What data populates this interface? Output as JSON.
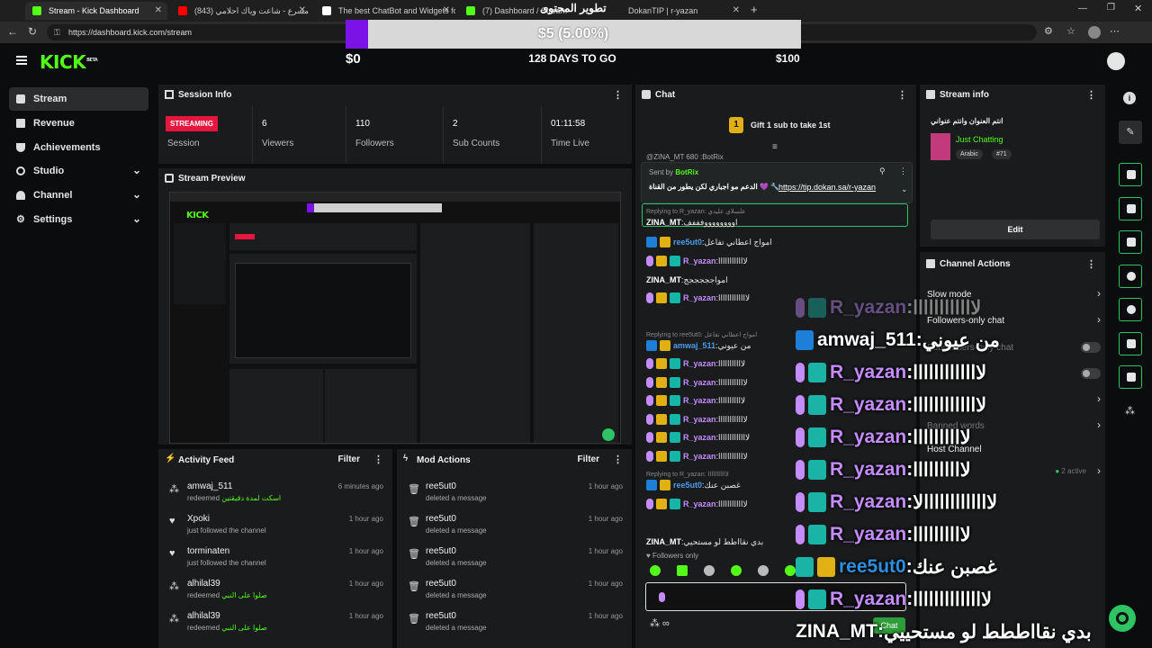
{
  "browser": {
    "tabs": [
      {
        "title": "Stream - Kick Dashboard",
        "color": "#53fc18"
      },
      {
        "title": "مسرع - شاعت وياك احلامي (843)",
        "color": "#ff0000"
      },
      {
        "title": "The best ChatBot and Widgets fo",
        "color": "#ffffff"
      },
      {
        "title": "(7) Dashboard / Stream",
        "color": "#53fc18"
      },
      {
        "title": "DokanTIP | r-yazan",
        "color": "#333333"
      }
    ],
    "url": "https://dashboard.kick.com/stream",
    "overlay_title": "تطوير المحتوى"
  },
  "goal": {
    "amount_label": "$5 (5.00%)",
    "progress_fraction": 0.05,
    "left_label": "$0",
    "center_label": "128 DAYS TO GO",
    "right_label": "$100"
  },
  "header": {
    "logo": "KICK",
    "beta": "BETA"
  },
  "sidebar": {
    "items": [
      {
        "label": "Stream",
        "active": true,
        "icon": "video-icon",
        "chevron": false
      },
      {
        "label": "Revenue",
        "active": false,
        "icon": "revenue-icon",
        "chevron": false
      },
      {
        "label": "Achievements",
        "active": false,
        "icon": "trophy-icon",
        "chevron": false
      },
      {
        "label": "Studio",
        "active": false,
        "icon": "studio-icon",
        "chevron": true
      },
      {
        "label": "Channel",
        "active": false,
        "icon": "person-icon",
        "chevron": true
      },
      {
        "label": "Settings",
        "active": false,
        "icon": "gear-icon",
        "chevron": true
      }
    ]
  },
  "session": {
    "title": "Session Info",
    "status_badge": "STREAMING",
    "status_label": "Session",
    "stats": [
      {
        "value": "6",
        "label": "Viewers"
      },
      {
        "value": "110",
        "label": "Followers"
      },
      {
        "value": "2",
        "label": "Sub Counts"
      },
      {
        "value": "01:11:58",
        "label": "Time Live"
      }
    ]
  },
  "preview": {
    "title": "Stream Preview"
  },
  "activity": {
    "title": "Activity Feed",
    "filter": "Filter",
    "rows": [
      {
        "name": "amwaj_511",
        "action": "redeemed",
        "reward": "اسكت لمدة دقيقتين",
        "time": "6 minutes ago",
        "icon": "gift-icon"
      },
      {
        "name": "Xpoki",
        "action": "just followed the channel",
        "reward": "",
        "time": "1 hour ago",
        "icon": "heart-icon"
      },
      {
        "name": "torminaten",
        "action": "just followed the channel",
        "reward": "",
        "time": "1 hour ago",
        "icon": "heart-icon"
      },
      {
        "name": "alhilal39",
        "action": "redeemed",
        "reward": "صلوا على النبي",
        "time": "1 hour ago",
        "icon": "gift-icon"
      },
      {
        "name": "alhilal39",
        "action": "redeemed",
        "reward": "صلوا على النبي",
        "time": "1 hour ago",
        "icon": "gift-icon"
      }
    ]
  },
  "mod": {
    "title": "Mod Actions",
    "filter": "Filter",
    "rows": [
      {
        "name": "ree5ut0",
        "action": "deleted a message",
        "time": "1 hour ago"
      },
      {
        "name": "ree5ut0",
        "action": "deleted a message",
        "time": "1 hour ago"
      },
      {
        "name": "ree5ut0",
        "action": "deleted a message",
        "time": "1 hour ago"
      },
      {
        "name": "ree5ut0",
        "action": "deleted a message",
        "time": "1 hour ago"
      },
      {
        "name": "ree5ut0",
        "action": "deleted a message",
        "time": "1 hour ago"
      }
    ]
  },
  "chat": {
    "title": "Chat",
    "gift_count": "1",
    "gift_text": "Gift 1 sub to take 1st",
    "pinned": {
      "sent_by": "Sent by",
      "bot": "BotRix",
      "message": "الدعم مو اجباري لكن يطور من القناة 💜 🔧",
      "link": "https://tip.dokan.sa/r-yazan"
    },
    "top_line": "@ZINA_MT 680 :BotRix",
    "lines": [
      {
        "user": "ZINA_MT",
        "text": "اووووووووفففف",
        "style": "white",
        "reply": "Replying to R_yazan: علسلاي عليدي"
      },
      {
        "user": "ree5ut0",
        "text": "امواج اعطاني تفاعل",
        "style": "blue"
      },
      {
        "user": "R_yazan",
        "text": "لاااااااااااا",
        "style": "purple"
      },
      {
        "user": "ZINA_MT",
        "text": "امواجججججج",
        "style": "white"
      },
      {
        "user": "R_yazan",
        "text": "لااااااااااااا",
        "style": "purple"
      },
      {
        "user": "amwaj_511",
        "text": "من عيوني",
        "style": "blue",
        "reply": "Replying to ree5ut0: امواج اعطاني تفاعل"
      },
      {
        "user": "R_yazan",
        "text": "لااااااااااا",
        "style": "purple"
      },
      {
        "user": "R_yazan",
        "text": "لاااااااااااا",
        "style": "purple"
      },
      {
        "user": "R_yazan",
        "text": "لااااااااااا",
        "style": "purple"
      },
      {
        "user": "R_yazan",
        "text": "لاااااااااااا",
        "style": "purple"
      },
      {
        "user": "R_yazan",
        "text": "لااااااااااااا",
        "style": "purple"
      },
      {
        "user": "R_yazan",
        "text": "لاااااااااااا",
        "style": "purple"
      },
      {
        "user": "ree5ut0",
        "text": "غصبن عنك",
        "style": "blue",
        "reply": "Replying to R_yazan: لااااااااااا"
      },
      {
        "user": "R_yazan",
        "text": "لاااااااااااا",
        "style": "purple"
      },
      {
        "user": "ZINA_MT",
        "text": "بدي نقااطط لو مستحيي",
        "style": "white"
      }
    ],
    "followers_only": "Followers only",
    "input_placeholder": "",
    "send_label": "Chat"
  },
  "overlay_chat": [
    {
      "user": "R_yazan",
      "text": "لاااااااااااا",
      "style": "purple",
      "faded": true
    },
    {
      "user": "amwaj_511",
      "text": "من عيوني",
      "style": "white"
    },
    {
      "user": "R_yazan",
      "text": "لااااااااااااا",
      "style": "purple"
    },
    {
      "user": "R_yazan",
      "text": "لااااااااااااا",
      "style": "purple"
    },
    {
      "user": "R_yazan",
      "text": "لاااااااااا",
      "style": "purple"
    },
    {
      "user": "R_yazan",
      "text": "لاااااااااا",
      "style": "purple"
    },
    {
      "user": "R_yazan",
      "text": "لااااااااااااالا",
      "style": "purple"
    },
    {
      "user": "R_yazan",
      "text": "لاااااااااا",
      "style": "purple"
    },
    {
      "user": "ree5ut0",
      "text": "غصبن عنك",
      "style": "blue"
    },
    {
      "user": "R_yazan",
      "text": "لاااااااااااااا",
      "style": "purple"
    },
    {
      "user": "ZINA_MT",
      "text": "بدي نقااططط لو مستحييي",
      "style": "white"
    }
  ],
  "stream_info": {
    "title": "Stream info",
    "stream_title": "انتم العنوان وانتم عنواني",
    "category": "Just Chatting",
    "tags": [
      "Arabic",
      "#71"
    ],
    "edit": "Edit"
  },
  "channel_actions": {
    "title": "Channel Actions",
    "rows": [
      {
        "label": "Slow mode",
        "control": "arrow"
      },
      {
        "label": "Followers-only chat",
        "control": "arrow"
      },
      {
        "label": "Subscribers-only chat",
        "control": "toggle"
      },
      {
        "label": "",
        "control": "toggle"
      },
      {
        "label": "",
        "control": "arrow"
      },
      {
        "label": "Banned words",
        "control": "arrow"
      },
      {
        "label": "Host Channel",
        "control": "none"
      },
      {
        "label": "",
        "control": "active",
        "extra": "2 active"
      }
    ]
  },
  "colors": {
    "kick_green": "#53fc18",
    "streaming_red": "#e5173f",
    "goal_purple": "#7b12e6"
  }
}
